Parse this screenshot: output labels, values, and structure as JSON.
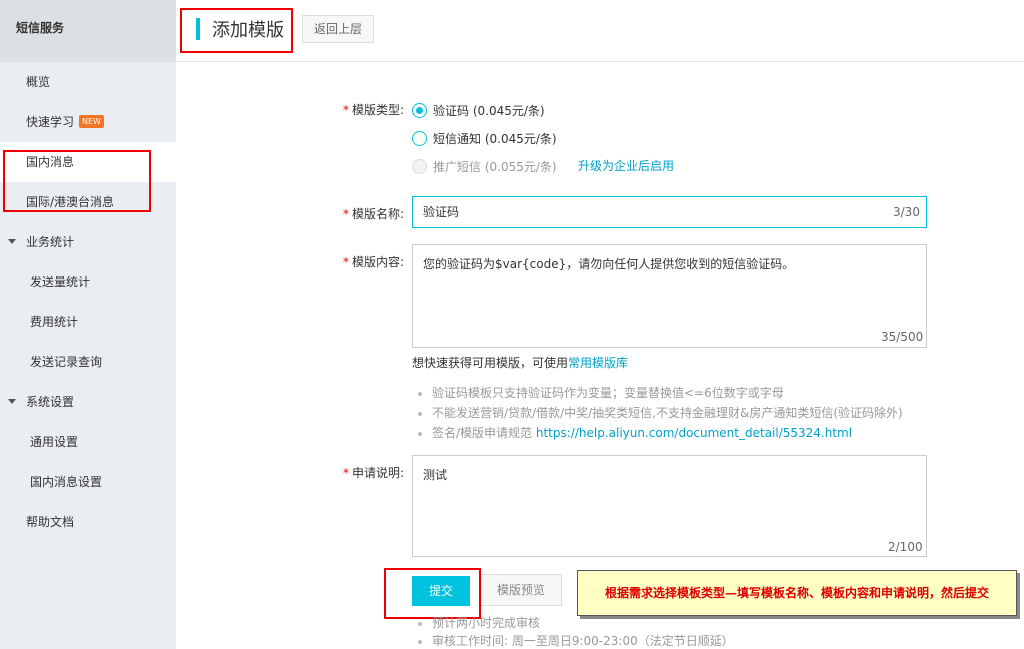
{
  "sidebar": {
    "title": "短信服务",
    "items": {
      "overview": "概览",
      "quick_learn": "快速学习",
      "quick_learn_badge": "NEW",
      "domestic": "国内消息",
      "international": "国际/港澳台消息",
      "biz_stats": "业务统计",
      "send_stats": "发送量统计",
      "fee_stats": "费用统计",
      "send_records": "发送记录查询",
      "system_settings": "系统设置",
      "general_settings": "通用设置",
      "domestic_settings": "国内消息设置",
      "help_docs": "帮助文档"
    }
  },
  "header": {
    "title": "添加模版",
    "back_label": "返回上层"
  },
  "form": {
    "type_label": "模版类型:",
    "type_options": [
      "验证码 (0.045元/条)",
      "短信通知 (0.045元/条)",
      "推广短信 (0.055元/条)"
    ],
    "upgrade_link": "升级为企业后启用",
    "name_label": "模版名称:",
    "name_value": "验证码",
    "name_counter": "3/30",
    "content_label": "模版内容:",
    "content_value": "您的验证码为$var{code}，请勿向任何人提供您收到的短信验证码。",
    "content_counter": "35/500",
    "hint_prefix": "想快速获得可用模版，可使用",
    "hint_link": "常用模版库",
    "notes": [
      "验证码模板只支持验证码作为变量；变量替换值<=6位数字或字母",
      "不能发送营销/贷款/借款/中奖/抽奖类短信,不支持金融理财&房产通知类短信(验证码除外)"
    ],
    "note3_prefix": "签名/模版申请规范 ",
    "note3_link": "https://help.aliyun.com/document_detail/55324.html",
    "desc_label": "申请说明:",
    "desc_value": "测试",
    "desc_counter": "2/100",
    "submit_label": "提交",
    "preview_label": "模版预览",
    "bottom_notes": [
      "预计两小时完成审核",
      "审核工作时间: 周一至周日9:00-23:00（法定节日顺延）"
    ],
    "required_mark": "*"
  },
  "callout": {
    "text": "根据需求选择模板类型—填写模板名称、模板内容和申请说明，然后提交"
  },
  "colors": {
    "accent": "#00c1de",
    "link": "#00a2ca",
    "highlight_border": "#e00000",
    "callout_bg": "#ffffc4"
  }
}
